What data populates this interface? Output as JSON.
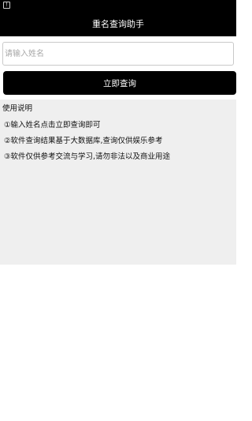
{
  "status_bar": {
    "icon": "warning-icon"
  },
  "app_bar": {
    "title": "重名查询助手"
  },
  "search": {
    "placeholder": "请输入姓名",
    "value": ""
  },
  "query_button": {
    "label": "立即查询"
  },
  "usage": {
    "title": "使用说明",
    "items": [
      "①输入姓名点击立即查询即可",
      "②软件查询结果基于大数据库,查询仅供娱乐参考",
      "③软件仅供参考交流与学习,请勿非法以及商业用途"
    ]
  }
}
